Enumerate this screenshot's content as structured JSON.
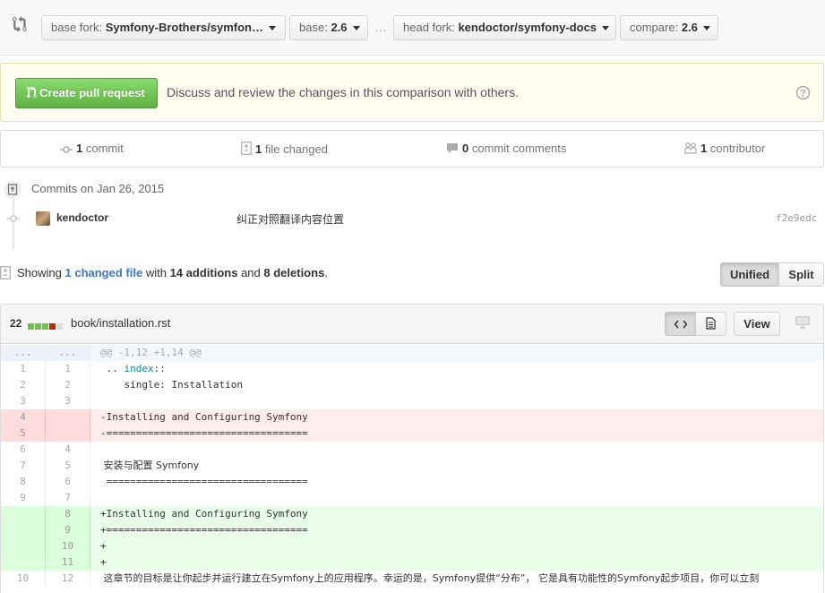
{
  "range": {
    "base_fork_prefix": "base fork:",
    "base_fork_value": "Symfony-Brothers/symfon…",
    "base_prefix": "base:",
    "base_value": "2.6",
    "dots": "…",
    "head_fork_prefix": "head fork:",
    "head_fork_value": "kendoctor/symfony-docs",
    "compare_prefix": "compare:",
    "compare_value": "2.6"
  },
  "banner": {
    "create_label": "Create pull request",
    "text": "Discuss and review the changes in this comparison with others."
  },
  "stats": {
    "commits_count": "1",
    "commits_label": "commit",
    "files_count": "1",
    "files_label": "file changed",
    "comments_count": "0",
    "comments_label": "commit comments",
    "contributors_count": "1",
    "contributors_label": "contributor"
  },
  "commits": {
    "heading": "Commits on Jan 26, 2015",
    "items": [
      {
        "author": "kendoctor",
        "message": "纠正对照翻译内容位置",
        "sha": "f2e9edc"
      }
    ]
  },
  "summary": {
    "showing": "Showing",
    "changed": "1 changed file",
    "with": "with",
    "additions": "14 additions",
    "and": "and",
    "deletions": "8 deletions",
    "period": ".",
    "unified": "Unified",
    "split": "Split"
  },
  "file": {
    "count": "22",
    "path": "book/installation.rst",
    "view_label": "View",
    "diffstat_colors": [
      "#6cc644",
      "#6cc644",
      "#6cc644",
      "#bd2c00",
      "#dddddd"
    ]
  },
  "diff": {
    "hunk": {
      "old": "...",
      "new": "...",
      "text": "@@ -1,12 +1,14 @@"
    },
    "rows": [
      {
        "type": "ctx",
        "old": "1",
        "new": "1",
        "pre": " .. ",
        "kw": "index",
        "post": "::"
      },
      {
        "type": "ctx",
        "old": "2",
        "new": "2",
        "text": "    single: Installation"
      },
      {
        "type": "ctx",
        "old": "3",
        "new": "3",
        "text": ""
      },
      {
        "type": "del",
        "old": "4",
        "new": "",
        "text": "-Installing and Configuring Symfony"
      },
      {
        "type": "del",
        "old": "5",
        "new": "",
        "text": "-=================================="
      },
      {
        "type": "ctx",
        "old": "6",
        "new": "4",
        "text": ""
      },
      {
        "type": "ctx",
        "old": "7",
        "new": "5",
        "text": " 安装与配置 Symfony"
      },
      {
        "type": "ctx",
        "old": "8",
        "new": "6",
        "text": " =================================="
      },
      {
        "type": "ctx",
        "old": "9",
        "new": "7",
        "text": ""
      },
      {
        "type": "add",
        "old": "",
        "new": "8",
        "text": "+Installing and Configuring Symfony"
      },
      {
        "type": "add",
        "old": "",
        "new": "9",
        "text": "+=================================="
      },
      {
        "type": "add",
        "old": "",
        "new": "10",
        "text": "+"
      },
      {
        "type": "add",
        "old": "",
        "new": "11",
        "text": "+"
      },
      {
        "type": "ctx",
        "old": "10",
        "new": "12",
        "text": " 这章节的目标是让你起步并运行建立在Symfony上的应用程序。幸运的是，Symfony提供“分布”， 它是具有功能性的Symfony起步项目，你可以立刻"
      }
    ]
  }
}
